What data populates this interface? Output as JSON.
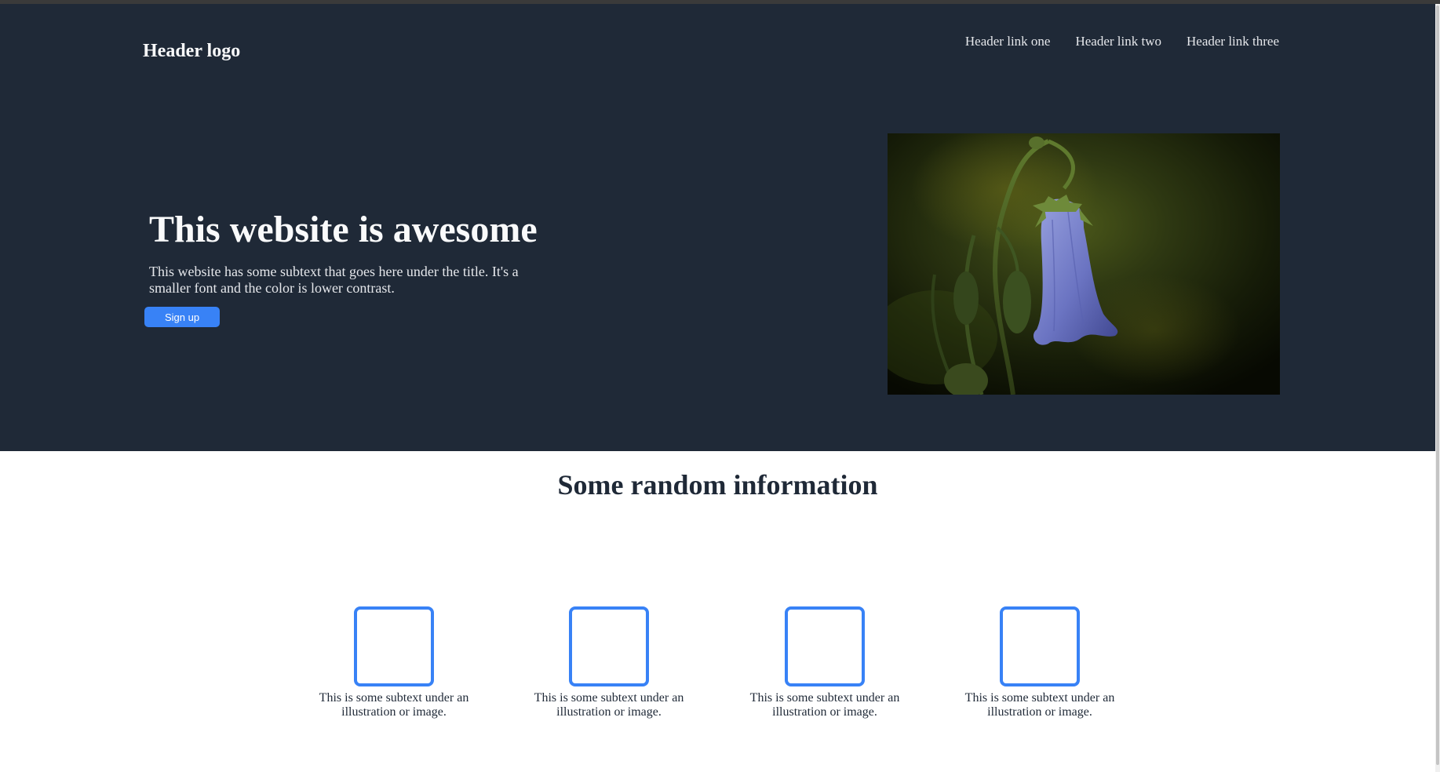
{
  "header": {
    "logo": "Header logo",
    "links": [
      "Header link one",
      "Header link two",
      "Header link three"
    ]
  },
  "hero": {
    "title": "This website is awesome",
    "subtitle": "This website has some subtext that goes here under the title. It's a smaller font and the color is lower contrast.",
    "button_label": "Sign up"
  },
  "info": {
    "title": "Some random information",
    "items": [
      {
        "text": "This is some subtext under an illustration or image."
      },
      {
        "text": "This is some subtext under an illustration or image."
      },
      {
        "text": "This is some subtext under an illustration or image."
      },
      {
        "text": "This is some subtext under an illustration or image."
      }
    ]
  },
  "colors": {
    "hero_bg": "#1f2937",
    "accent": "#3882f6",
    "text_light": "#f9fafb",
    "text_dark": "#1f2937"
  }
}
